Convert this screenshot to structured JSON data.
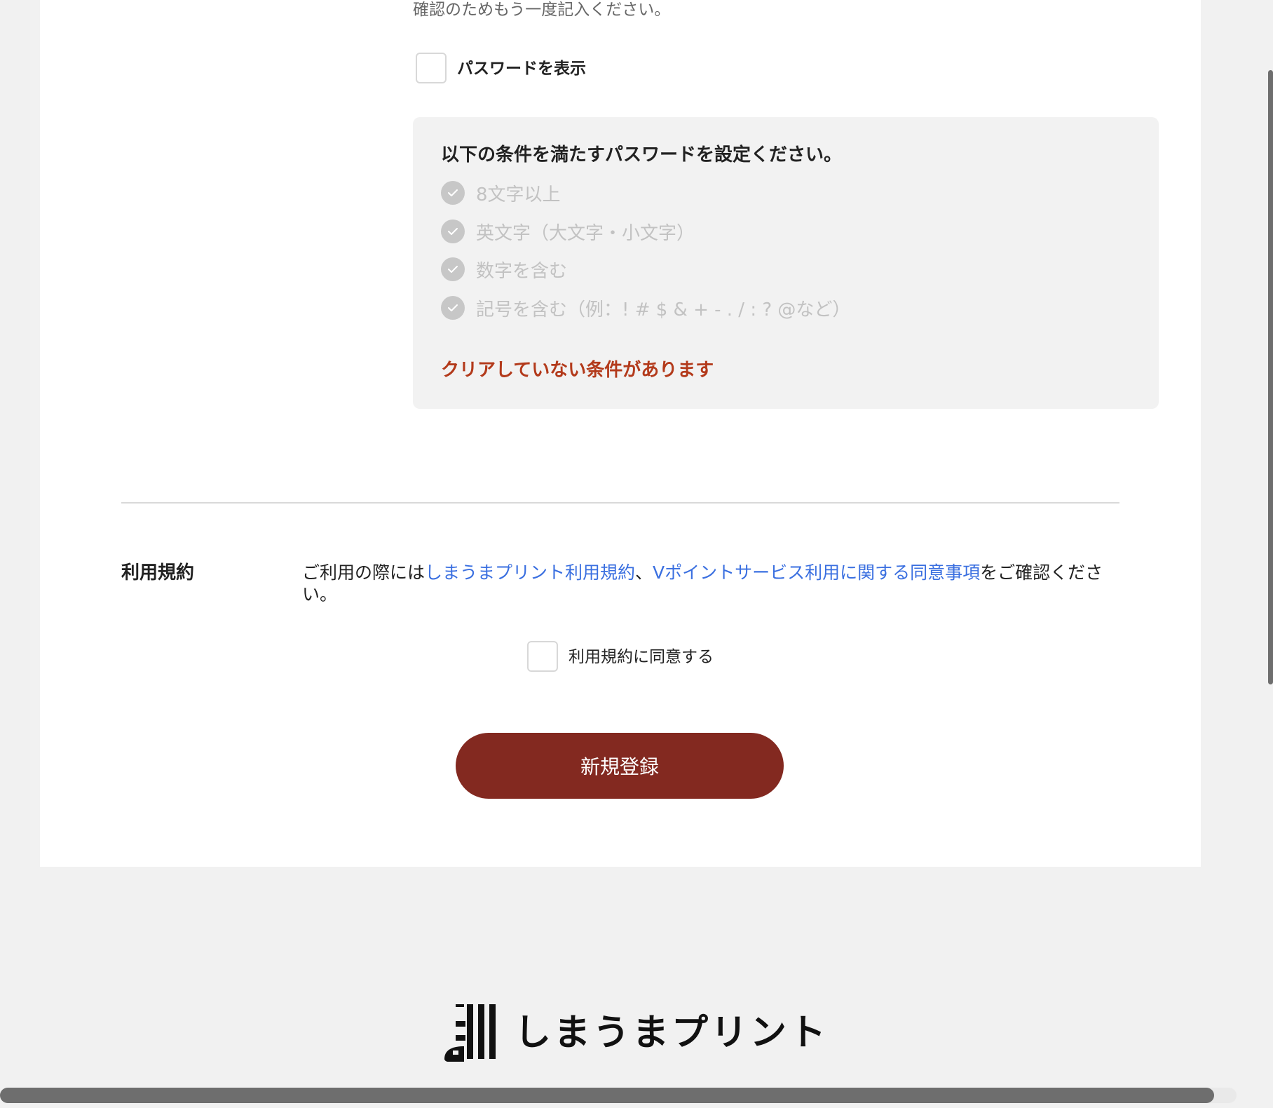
{
  "password_section": {
    "confirm_hint": "確認のためもう一度記入ください。",
    "show_password_label": "パスワードを表示"
  },
  "requirements": {
    "title": "以下の条件を満たすパスワードを設定ください。",
    "items": [
      "8文字以上",
      "英文字（大文字・小文字）",
      "数字を含む",
      "記号を含む（例：! # $ & + - . / : ? @など）"
    ],
    "error": "クリアしていない条件があります"
  },
  "terms": {
    "heading": "利用規約",
    "text_prefix": "ご利用の際には",
    "link_1": "しまうまプリント利用規約",
    "separator": "、",
    "link_2": "Vポイントサービス利用に関する同意事項",
    "text_suffix": "をご確認ください。",
    "agree_label": "利用規約に同意する"
  },
  "actions": {
    "register_label": "新規登録"
  },
  "footer": {
    "logo_text": "しまうまプリント"
  },
  "colors": {
    "accent_button": "#832920",
    "error_text": "#b33a1b",
    "link": "#3a6fe0"
  }
}
